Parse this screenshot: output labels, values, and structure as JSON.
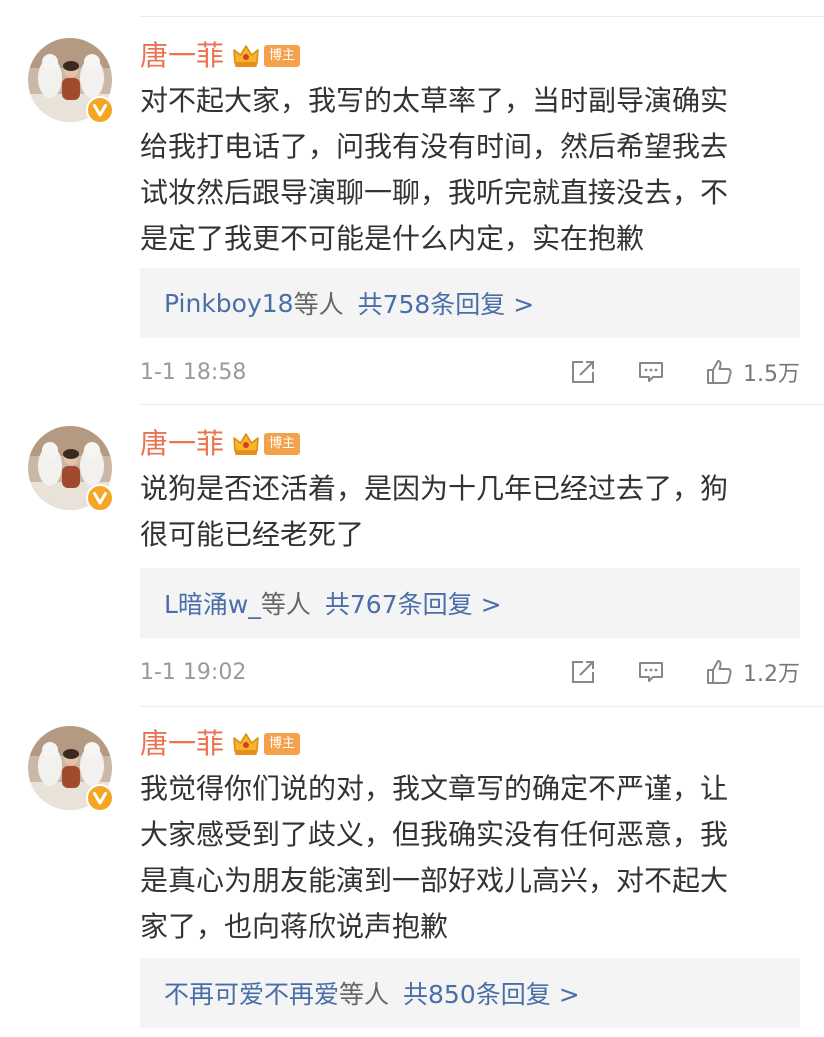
{
  "comments": [
    {
      "author": "唐一菲",
      "badge": "博主",
      "lines": [
        "对不起大家，我写的太草率了，当时副导演确实",
        "给我打电话了，问我有没有时间，然后希望我去",
        "试妆然后跟导演聊一聊，我听完就直接没去，不",
        "是定了我更不可能是什么内定，实在抱歉"
      ],
      "reply_users": "Pinkboy18",
      "reply_suffix": "等人",
      "reply_count": "共758条回复 >",
      "timestamp": "1-1 18:58",
      "likes": "1.5万"
    },
    {
      "author": "唐一菲",
      "badge": "博主",
      "lines": [
        "说狗是否还活着，是因为十几年已经过去了，狗",
        "很可能已经老死了"
      ],
      "reply_users": "L暗涌w_",
      "reply_suffix": "等人",
      "reply_count": "共767条回复 >",
      "timestamp": "1-1 19:02",
      "likes": "1.2万"
    },
    {
      "author": "唐一菲",
      "badge": "博主",
      "lines": [
        "我觉得你们说的对，我文章写的确定不严谨，让",
        "大家感受到了歧义，但我确实没有任何恶意，我",
        "是真心为朋友能演到一部好戏儿高兴，对不起大",
        "家了，也向蒋欣说声抱歉"
      ],
      "reply_users": "不再可爱不再爱",
      "reply_suffix": "等人",
      "reply_count": "共850条回复 >",
      "timestamp": "",
      "likes": ""
    }
  ],
  "icons": {
    "crown": "crown-icon",
    "verified": "verified-v-icon",
    "forward": "forward-icon",
    "comment": "comment-icon",
    "like": "thumbs-up-icon"
  },
  "colors": {
    "author_name": "#eb7350",
    "reply_link": "#4a6ea8",
    "badge_bg": "#f3a24b",
    "verified_badge": "#f5a623"
  }
}
